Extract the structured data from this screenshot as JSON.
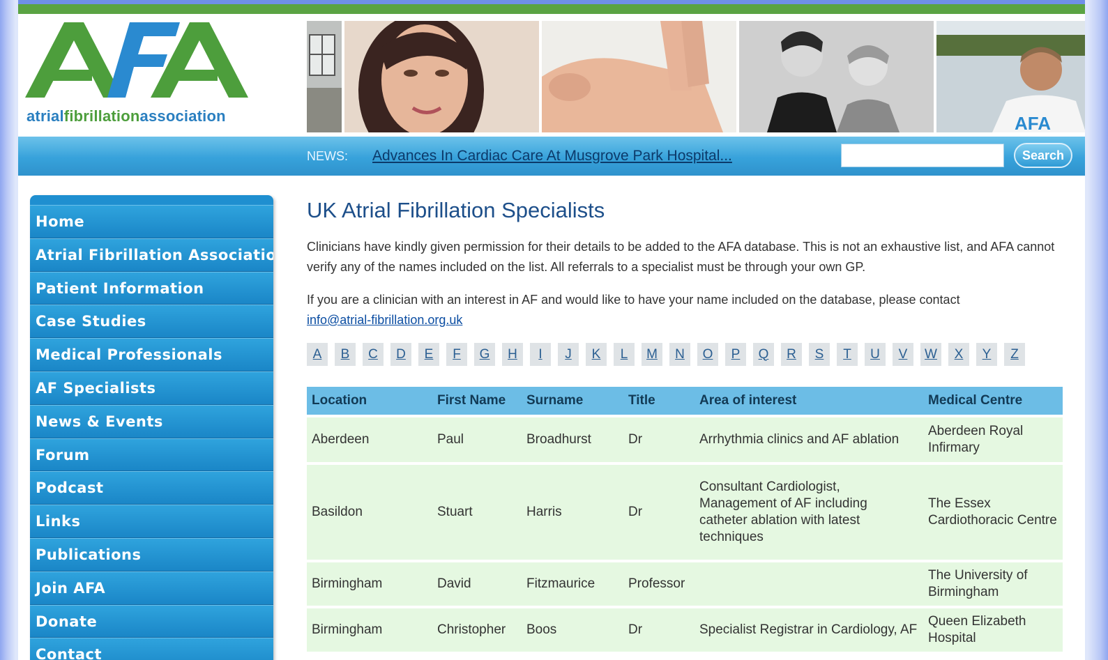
{
  "logo": {
    "mark": "AFA",
    "text_a": "atrial",
    "text_b": "fibrillation",
    "text_c": "association"
  },
  "news": {
    "label": "NEWS:",
    "link": "Advances In Cardiac Care At Musgrove Park Hospital..."
  },
  "search": {
    "button": "Search",
    "placeholder": ""
  },
  "sidebar": {
    "items": [
      "Home",
      "Atrial Fibrillation Association",
      "Patient Information",
      "Case Studies",
      "Medical Professionals",
      "AF Specialists",
      "News & Events",
      "Forum",
      "Podcast",
      "Links",
      "Publications",
      "Join AFA",
      "Donate",
      "Contact"
    ]
  },
  "main": {
    "title": "UK Atrial Fibrillation Specialists",
    "intro": "Clinicians have kindly given permission for their details to be added to the AFA database. This is not an exhaustive list, and AFA cannot verify any of the names included on the list. All referrals to a specialist must be through your own GP.",
    "contact_text": "If you are a clinician with an interest in AF and would like to have your name included on the database, please contact",
    "contact_email": "info@atrial-fibrillation.org.uk",
    "alphabet": [
      "A",
      "B",
      "C",
      "D",
      "E",
      "F",
      "G",
      "H",
      "I",
      "J",
      "K",
      "L",
      "M",
      "N",
      "O",
      "P",
      "Q",
      "R",
      "S",
      "T",
      "U",
      "V",
      "W",
      "X",
      "Y",
      "Z"
    ]
  },
  "table": {
    "headers": [
      "Location",
      "First Name",
      "Surname",
      "Title",
      "Area of interest",
      "Medical Centre"
    ],
    "rows": [
      [
        "Aberdeen",
        "Paul",
        "Broadhurst",
        "Dr",
        "Arrhythmia clinics and AF ablation",
        "Aberdeen Royal Infirmary"
      ],
      [
        "Basildon",
        "Stuart",
        "Harris",
        "Dr",
        "Consultant Cardiologist, Management of AF including catheter ablation with latest techniques",
        "The Essex Cardiothoracic Centre"
      ],
      [
        "Birmingham",
        "David",
        "Fitzmaurice",
        "Professor",
        "",
        "The University of Birmingham"
      ],
      [
        "Birmingham",
        "Christopher",
        "Boos",
        "Dr",
        "Specialist Registrar in Cardiology, AF",
        "Queen Elizabeth Hospital"
      ]
    ]
  },
  "colors": {
    "green": "#5aa343",
    "blue": "#2f92cc",
    "header_row": "#6cbde6",
    "row_bg": "#e5f8e1"
  }
}
